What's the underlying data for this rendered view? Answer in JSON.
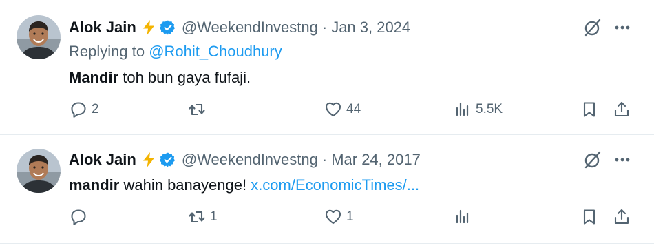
{
  "tweets": [
    {
      "author_name": "Alok Jain",
      "handle": "@WeekendInvestng",
      "separator": "·",
      "date": "Jan 3, 2024",
      "replying_prefix": "Replying to",
      "replying_to": "@Rohit_Choudhury",
      "text_bold": "Mandir",
      "text_rest": " toh bun gaya fufaji.",
      "link": "",
      "stats": {
        "replies": "2",
        "retweets": "",
        "likes": "44",
        "views": "5.5K"
      }
    },
    {
      "author_name": "Alok Jain",
      "handle": "@WeekendInvestng",
      "separator": "·",
      "date": "Mar 24, 2017",
      "text_bold": "mandir",
      "text_rest": " wahin banayenge! ",
      "link": "x.com/EconomicTimes/...",
      "stats": {
        "replies": "",
        "retweets": "1",
        "likes": "1",
        "views": ""
      }
    }
  ],
  "colors": {
    "accent": "#1d9bf0",
    "muted": "#536471",
    "text": "#0f1419",
    "bolt": "#f4b400"
  },
  "icons": [
    "bolt-icon",
    "verified-badge-icon",
    "grok-icon",
    "more-icon",
    "reply-icon",
    "retweet-icon",
    "like-icon",
    "views-icon",
    "bookmark-icon",
    "share-icon"
  ]
}
